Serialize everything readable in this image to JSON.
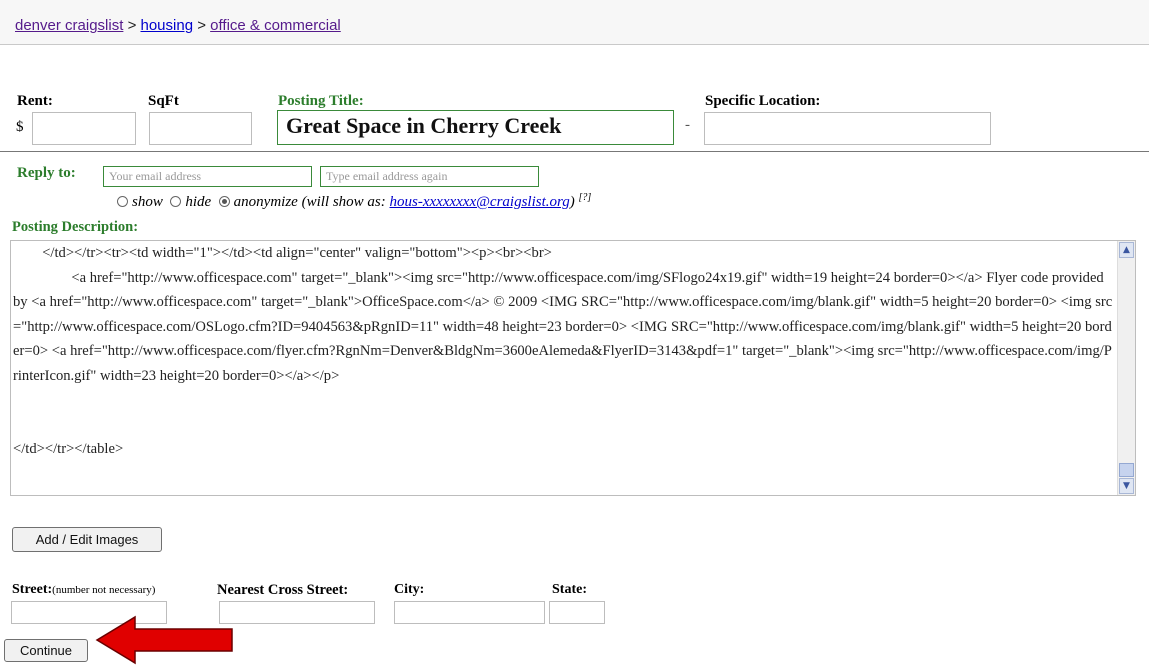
{
  "breadcrumb": {
    "site": "denver craigslist",
    "sep1": ">",
    "category": "housing",
    "sep2": ">",
    "subcategory": "office & commercial"
  },
  "form": {
    "rent_label": "Rent:",
    "currency": "$",
    "sqft_label": "SqFt",
    "posting_title_label": "Posting Title:",
    "posting_title_value": "Great Space in Cherry Creek",
    "dash": "-",
    "specific_location_label": "Specific Location:",
    "reply_to_label": "Reply to:",
    "email_placeholder": "Your email address",
    "email_again_placeholder": "Type email address again",
    "reply_options": [
      "show",
      "hide",
      "anonymize (will show as:"
    ],
    "reply_selected": "anonymize (will show as:",
    "anon_email": "hous-xxxxxxxx@craigslist.org",
    "anon_close": ")",
    "help_link": "[?]",
    "posting_description_label": "Posting Description:",
    "posting_description_value": "        </td></tr><tr><td width=\"1\"></td><td align=\"center\" valign=\"bottom\"><p><br><br>\n                <a href=\"http://www.officespace.com\" target=\"_blank\"><img src=\"http://www.officespace.com/img/SFlogo24x19.gif\" width=19 height=24 border=0></a> Flyer code provided by <a href=\"http://www.officespace.com\" target=\"_blank\">OfficeSpace.com</a> © 2009 <IMG SRC=\"http://www.officespace.com/img/blank.gif\" width=5 height=20 border=0> <img src=\"http://www.officespace.com/OSLogo.cfm?ID=9404563&pRgnID=11\" width=48 height=23 border=0> <IMG SRC=\"http://www.officespace.com/img/blank.gif\" width=5 height=20 border=0> <a href=\"http://www.officespace.com/flyer.cfm?RgnNm=Denver&BldgNm=3600eAlemeda&FlyerID=3143&pdf=1\" target=\"_blank\"><img src=\"http://www.officespace.com/img/PrinterIcon.gif\" width=23 height=20 border=0></a></p>\n\n\n</td></tr></table>",
    "add_images_button": "Add / Edit Images",
    "street_label": "Street:",
    "street_note": "(number not necessary)",
    "cross_street_label": "Nearest Cross Street:",
    "city_label": "City:",
    "state_label": "State:",
    "continue_button": "Continue"
  },
  "icons": {
    "scroll_up": "scroll-up-icon",
    "scroll_down": "scroll-down-icon",
    "annotation_arrow": "red-arrow-icon"
  },
  "colors": {
    "label_green": "#2c7d2c",
    "link_purple": "#551a8b",
    "link_blue": "#0000cc",
    "arrow_red": "#e00000"
  }
}
